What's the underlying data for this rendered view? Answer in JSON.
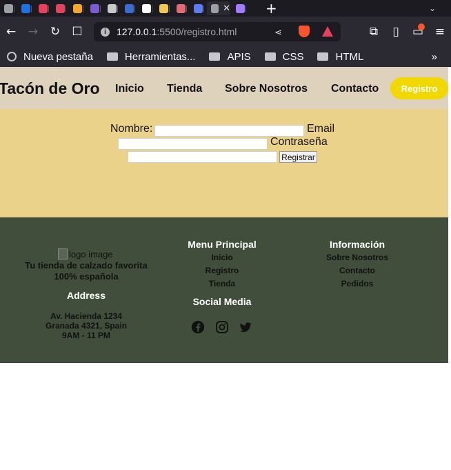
{
  "browser": {
    "url_host": "127.0.0.1",
    "url_path": ":5500/registro.html",
    "bookmarks": [
      {
        "label": "Nueva pestaña",
        "icon": "globe-icon"
      },
      {
        "label": "Herramientas...",
        "icon": "folder-icon"
      },
      {
        "label": "APIS",
        "icon": "folder-icon"
      },
      {
        "label": "CSS",
        "icon": "folder-icon"
      },
      {
        "label": "HTML",
        "icon": "folder-icon"
      }
    ],
    "bookmarks_more": "»",
    "tab_colors": [
      "#9aa0a6",
      "#1a73e8",
      "#e8415e",
      "#e8415e",
      "#f4a72a",
      "#7b5cd6",
      "#c9c9c9",
      "#3b6bd6",
      "#ffffff",
      "#f2c94c",
      "#e06c75",
      "#5b7cfa",
      "#9aa0a6",
      "#a37bff"
    ]
  },
  "site": {
    "brand": "Tacón de Oro",
    "nav": {
      "inicio": "Inicio",
      "tienda": "Tienda",
      "sobre": "Sobre Nosotros",
      "contacto": "Contacto",
      "registro": "Registro"
    },
    "form": {
      "nombre_label": "Nombre:",
      "email_label": "Email",
      "password_label": "Contraseña",
      "submit_label": "Registrar"
    },
    "footer": {
      "logo_alt": "logo image",
      "tagline": "Tu tienda de calzado favorita",
      "tagline2": "100% española",
      "address_heading": "Address",
      "address_line1": "Av. Hacienda 1234",
      "address_line2": "Granada 4321, Spain",
      "hours": "9AM - 11 PM",
      "menu_heading": "Menu Principal",
      "menu_links": [
        "Inicio",
        "Registro",
        "Tienda"
      ],
      "social_heading": "Social Media",
      "info_heading": "Información",
      "info_links": [
        "Sobre Nosotros",
        "Contacto",
        "Pedidos"
      ]
    }
  },
  "colors": {
    "navbar_bg": "#ded2bd",
    "form_bg": "#ebd28a",
    "footer_bg": "#414e3b",
    "register_button": "#f1d800"
  }
}
